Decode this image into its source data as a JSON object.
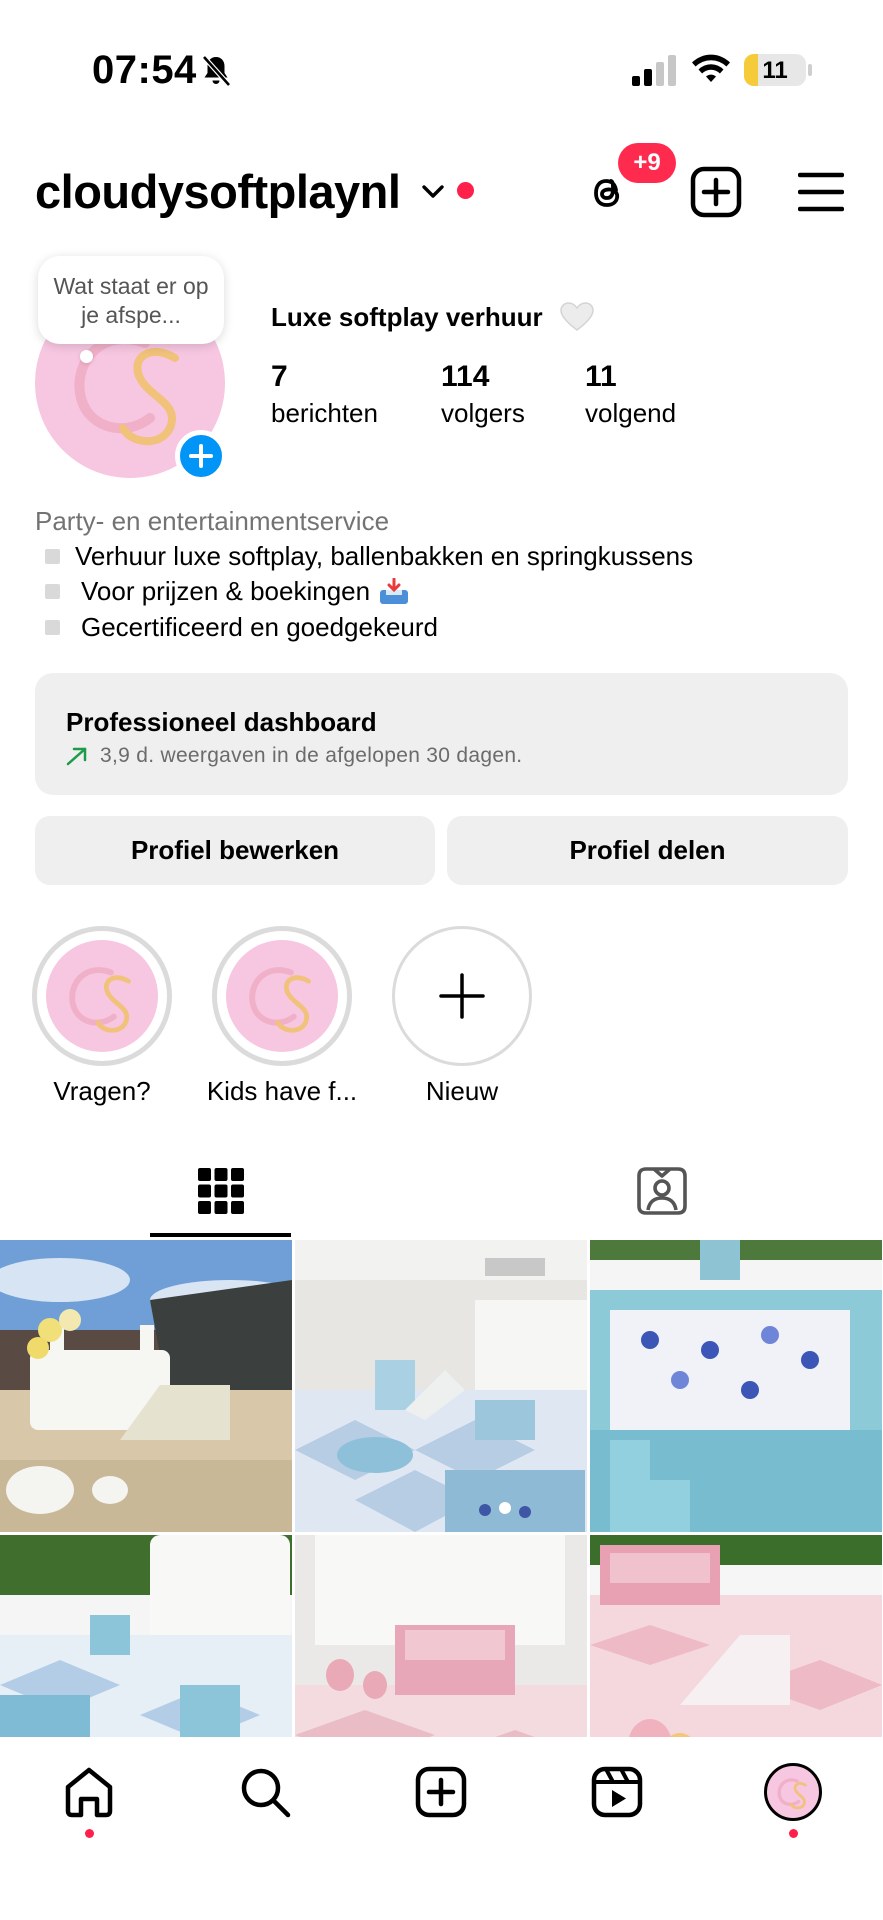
{
  "status_bar": {
    "time": "07:54",
    "battery_level": "11",
    "icons": [
      "bell-slash-icon",
      "cellular-signal-icon",
      "wifi-icon",
      "battery-icon"
    ]
  },
  "header": {
    "username": "cloudysoftplaynl",
    "notification_badge": "+9",
    "icons": [
      "chevron-down-icon",
      "threads-icon",
      "add-post-icon",
      "menu-icon"
    ]
  },
  "note": {
    "text": "Wat staat er op je afspe..."
  },
  "profile": {
    "display_name": "Luxe softplay verhuur",
    "stats": [
      {
        "value": "7",
        "label": "berichten"
      },
      {
        "value": "114",
        "label": "volgers"
      },
      {
        "value": "11",
        "label": "volgend"
      }
    ],
    "category": "Party- en entertainmentservice",
    "bio_lines": [
      "Verhuur luxe softplay, ballenbakken en springkussens",
      "Voor prijzen & boekingen",
      "Gecertificeerd en goedgekeurd"
    ]
  },
  "dashboard": {
    "title": "Professioneel dashboard",
    "subtitle": "3,9 d. weergaven in de afgelopen 30 dagen."
  },
  "actions": {
    "edit_profile": "Profiel bewerken",
    "share_profile": "Profiel delen"
  },
  "highlights": [
    {
      "label": "Vragen?"
    },
    {
      "label": "Kids have f..."
    },
    {
      "label": "Nieuw"
    }
  ],
  "tabs": [
    "grid-icon",
    "tagged-icon"
  ],
  "bottom_nav": [
    "home-icon",
    "search-icon",
    "create-icon",
    "reels-icon",
    "profile-avatar"
  ],
  "colors": {
    "accent_blue": "#0095f6",
    "badge_red": "#ff2b4f",
    "brand_pink": "#f7c6e1",
    "button_gray": "#efeff0"
  }
}
